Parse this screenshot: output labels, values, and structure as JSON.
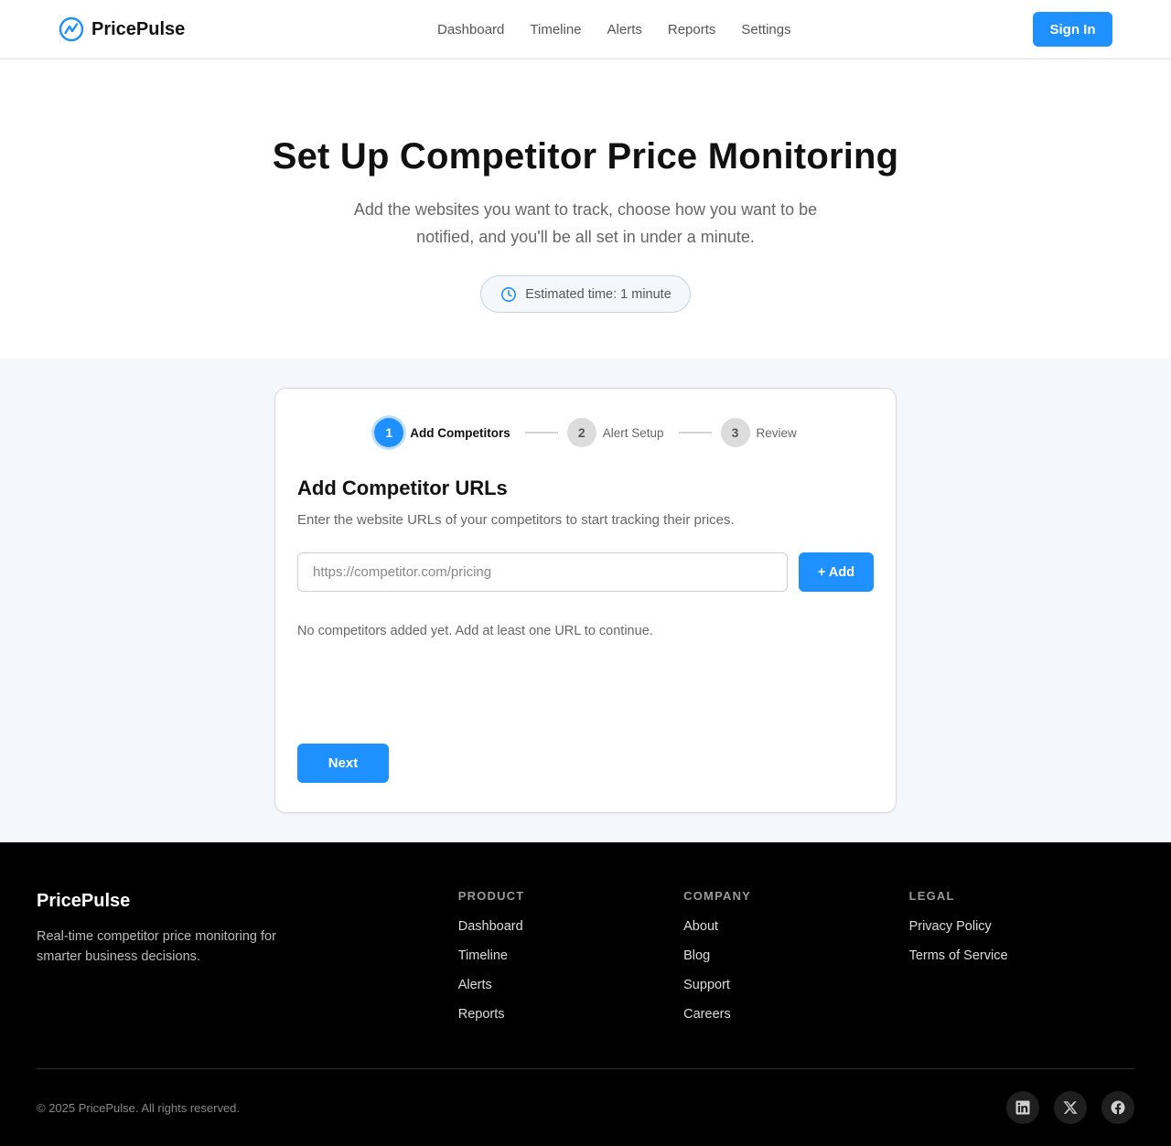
{
  "header": {
    "brand": "PricePulse",
    "nav": [
      "Dashboard",
      "Timeline",
      "Alerts",
      "Reports",
      "Settings"
    ],
    "signin": "Sign In"
  },
  "hero": {
    "title": "Set Up Competitor Price Monitoring",
    "subtitle": "Add the websites you want to track, choose how you want to be notified, and you'll be all set in under a minute.",
    "badge": "Estimated time: 1 minute"
  },
  "stepper": {
    "steps": [
      {
        "number": "1",
        "label": "Add Competitors",
        "active": true
      },
      {
        "number": "2",
        "label": "Alert Setup",
        "active": false
      },
      {
        "number": "3",
        "label": "Review",
        "active": false
      }
    ]
  },
  "card": {
    "title": "Add Competitor URLs",
    "description": "Enter the website URLs of your competitors to start tracking their prices.",
    "url_placeholder": "https://competitor.com/pricing",
    "add_label": "+ Add",
    "empty_message": "No competitors added yet. Add at least one URL to continue.",
    "next_label": "Next"
  },
  "footer": {
    "brand": "PricePulse",
    "description": "Real-time competitor price monitoring for smarter business decisions.",
    "columns": [
      {
        "heading": "PRODUCT",
        "links": [
          "Dashboard",
          "Timeline",
          "Alerts",
          "Reports"
        ]
      },
      {
        "heading": "COMPANY",
        "links": [
          "About",
          "Blog",
          "Support",
          "Careers"
        ]
      },
      {
        "heading": "LEGAL",
        "links": [
          "Privacy Policy",
          "Terms of Service"
        ]
      }
    ],
    "copyright": "© 2025 PricePulse. All rights reserved.",
    "socials": [
      "linkedin-icon",
      "x-icon",
      "facebook-icon"
    ]
  },
  "colors": {
    "accent": "#1e90ff",
    "footer_bg": "#000000",
    "section_bg": "#f4f7fb"
  }
}
